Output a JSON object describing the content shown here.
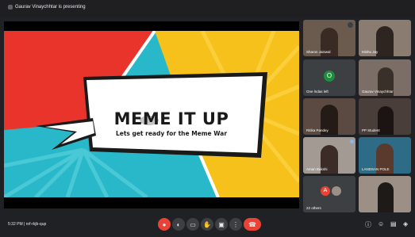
{
  "header": {
    "presenting_text": "Gaurav Vinaychhtar is presenting"
  },
  "slide": {
    "title": "MEME IT UP",
    "subtitle": "Lets get ready for the Meme War"
  },
  "participants": [
    {
      "name": "Sharon Jaiswal",
      "bg": "#6b5b4f"
    },
    {
      "name": "Mishu Jay",
      "bg": "#8a7c70"
    },
    {
      "name": "One lndas left",
      "bg": "#3c4043",
      "avatar_letter": "O",
      "avatar_color": "#1e8e3e"
    },
    {
      "name": "Gaurav Vinaychhtar",
      "bg": "#7a6e66"
    },
    {
      "name": "Ritika Pandey",
      "bg": "#5a4a42"
    },
    {
      "name": "PP Student",
      "bg": "#4a3e3a"
    },
    {
      "name": "Aman Bakshi",
      "bg": "#a39a94"
    },
    {
      "name": "LANDSAN POLE",
      "bg": "#2d6b86"
    },
    {
      "name": "22 others",
      "bg": "#3c4043",
      "avatar_letter": "A",
      "avatar_color": "#ea4335"
    },
    {
      "name": "",
      "bg": "#9b8f86"
    }
  ],
  "bottom": {
    "time_code": "5:32 PM  |  nrf-rkjb-qup"
  },
  "controls": {
    "mic_icon": "mic-off-icon",
    "cam_icon": "camera-icon",
    "captions_icon": "captions-icon",
    "hand_icon": "raise-hand-icon",
    "present_icon": "present-icon",
    "more_icon": "more-icon",
    "end_icon": "end-call-icon"
  },
  "colors": {
    "slide_red": "#e8342a",
    "slide_yellow": "#f7c11c",
    "slide_teal": "#28b8c9",
    "end_call": "#ea4335"
  }
}
